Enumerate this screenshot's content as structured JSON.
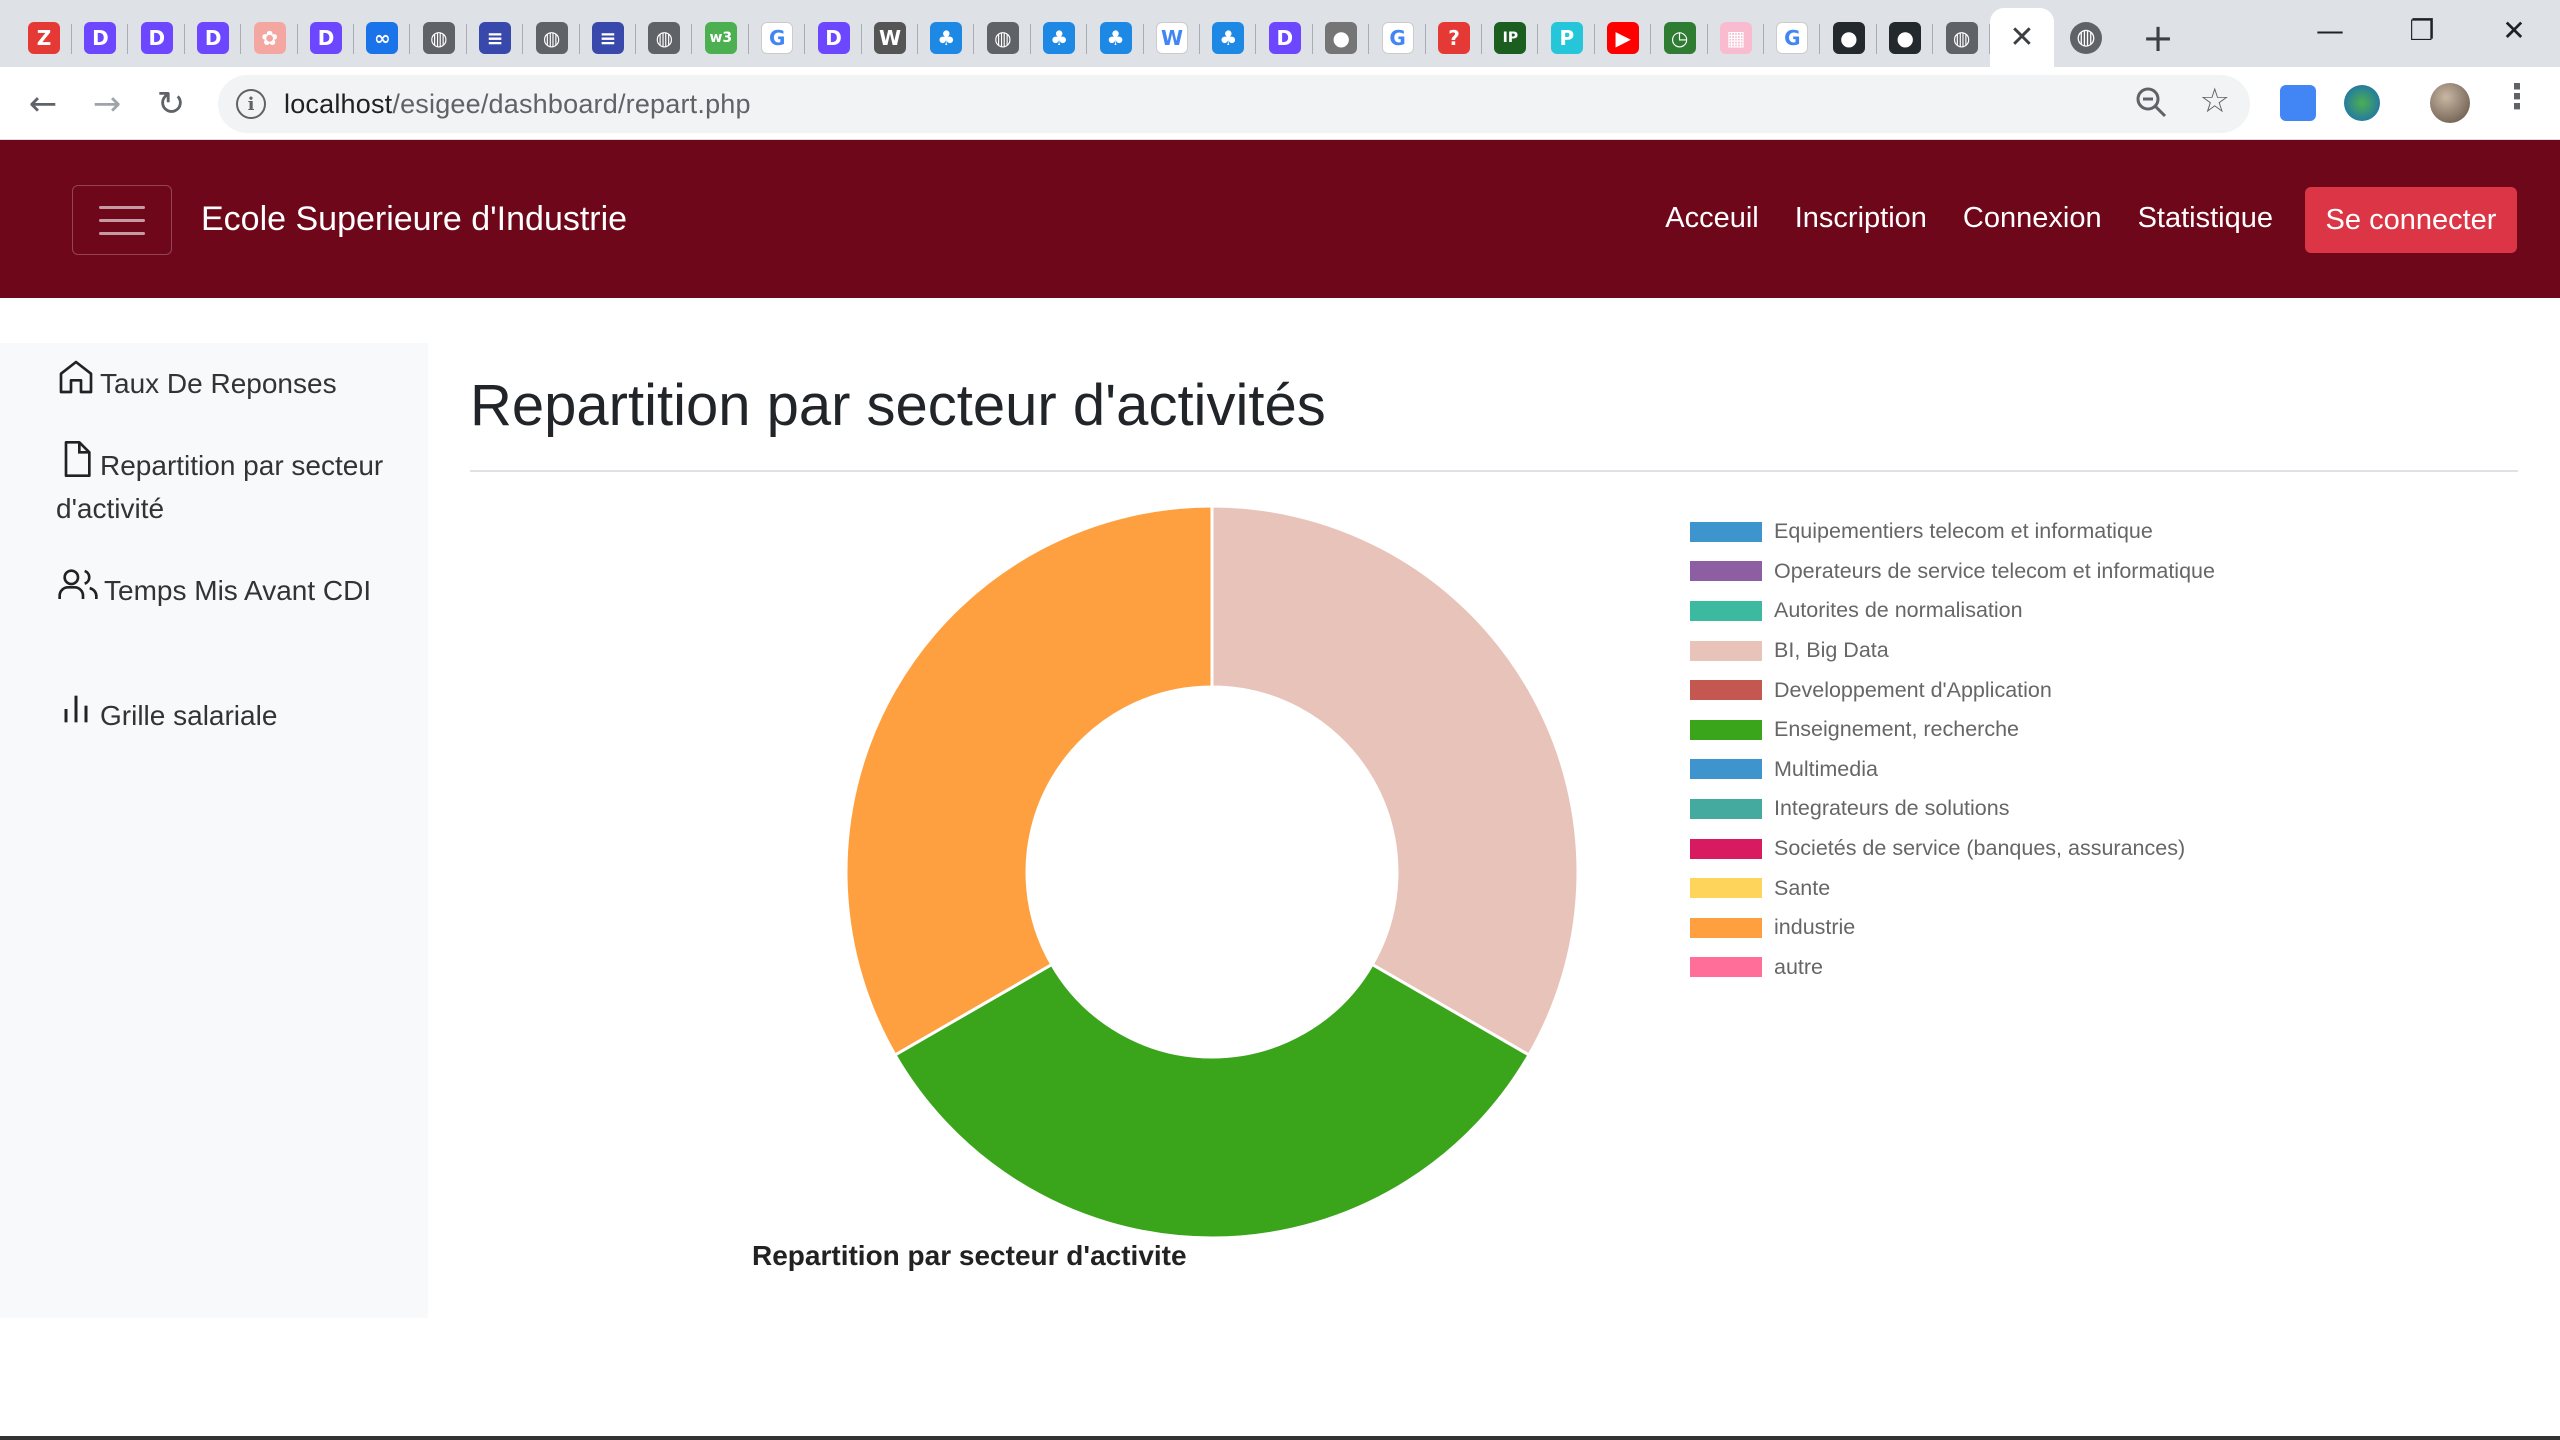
{
  "browser": {
    "favicons": [
      {
        "name": "zotero-icon",
        "color": "#e53935",
        "glyph": "Z"
      },
      {
        "name": "tab-app-icon",
        "color": "#6c47ff",
        "glyph": "D"
      },
      {
        "name": "tab-app-icon",
        "color": "#6c47ff",
        "glyph": "D"
      },
      {
        "name": "tab-app-icon",
        "color": "#6c47ff",
        "glyph": "D"
      },
      {
        "name": "cookie-icon",
        "color": "#f4a7a0",
        "glyph": "✿"
      },
      {
        "name": "tab-app-icon",
        "color": "#6c47ff",
        "glyph": "D"
      },
      {
        "name": "infinity-icon",
        "color": "#1a73e8",
        "glyph": "∞"
      },
      {
        "name": "globe-icon",
        "color": "#5f6368",
        "glyph": "◍"
      },
      {
        "name": "stack-icon",
        "color": "#3949ab",
        "glyph": "≡"
      },
      {
        "name": "globe-icon",
        "color": "#5f6368",
        "glyph": "◍"
      },
      {
        "name": "stack-icon",
        "color": "#3949ab",
        "glyph": "≡"
      },
      {
        "name": "globe-icon",
        "color": "#5f6368",
        "glyph": "◍"
      },
      {
        "name": "w3-icon",
        "color": "#4caf50",
        "glyph": "w3"
      },
      {
        "name": "google-icon",
        "color": "#ffffff",
        "glyph": "G"
      },
      {
        "name": "tab-app-icon",
        "color": "#6c47ff",
        "glyph": "D"
      },
      {
        "name": "wp-icon",
        "color": "#555555",
        "glyph": "W"
      },
      {
        "name": "ghost-icon",
        "color": "#1e88e5",
        "glyph": "♣"
      },
      {
        "name": "globe-icon",
        "color": "#5f6368",
        "glyph": "◍"
      },
      {
        "name": "ghost-icon",
        "color": "#1e88e5",
        "glyph": "♣"
      },
      {
        "name": "ghost-icon",
        "color": "#1e88e5",
        "glyph": "♣"
      },
      {
        "name": "wikipedia-icon",
        "color": "#ffffff",
        "glyph": "W"
      },
      {
        "name": "ghost-icon",
        "color": "#1e88e5",
        "glyph": "♣"
      },
      {
        "name": "tab-app-icon",
        "color": "#6c47ff",
        "glyph": "D"
      },
      {
        "name": "disc-icon",
        "color": "#757575",
        "glyph": "●"
      },
      {
        "name": "google-icon",
        "color": "#ffffff",
        "glyph": "G"
      },
      {
        "name": "quora-icon",
        "color": "#e53935",
        "glyph": "?"
      },
      {
        "name": "ip-icon",
        "color": "#1b5e20",
        "glyph": "IP"
      },
      {
        "name": "p-icon",
        "color": "#26c6da",
        "glyph": "P"
      },
      {
        "name": "youtube-icon",
        "color": "#ff0000",
        "glyph": "▶"
      },
      {
        "name": "timer-icon",
        "color": "#2e7d32",
        "glyph": "◷"
      },
      {
        "name": "building-icon",
        "color": "#f8bbd0",
        "glyph": "▦"
      },
      {
        "name": "google-icon",
        "color": "#ffffff",
        "glyph": "G"
      },
      {
        "name": "github-icon",
        "color": "#24292e",
        "glyph": "●"
      },
      {
        "name": "github-icon",
        "color": "#24292e",
        "glyph": "●"
      },
      {
        "name": "globe-icon",
        "color": "#5f6368",
        "glyph": "◍"
      }
    ],
    "active_tab_close": "✕",
    "last_tab_icon": "◍",
    "new_tab": "+",
    "window_controls": {
      "minimize": "—",
      "restore": "❐",
      "close": "✕"
    },
    "url_host": "localhost",
    "url_path": "/esigee/dashboard/repart.php"
  },
  "navbar": {
    "brand": "Ecole Superieure d'Industrie",
    "links": [
      "Acceuil",
      "Inscription",
      "Connexion",
      "Statistique"
    ],
    "cta": "Se connecter",
    "bg_color": "#6f071b",
    "cta_color": "#dc3545"
  },
  "sidebar": {
    "items": [
      {
        "label": "Taux De Reponses",
        "icon": "home-icon"
      },
      {
        "label": "Repartition par secteur d'activité",
        "icon": "file-icon"
      },
      {
        "label": "Temps Mis Avant CDI",
        "icon": "users-icon"
      },
      {
        "label": "Grille salariale",
        "icon": "bar-chart-icon"
      }
    ]
  },
  "main": {
    "title": "Repartition par secteur d'activités"
  },
  "chart_data": {
    "type": "pie",
    "title": "Repartition par secteur d'activite",
    "donut": true,
    "legend_position": "right",
    "categories": [
      "Equipementiers telecom et informatique",
      "Operateurs de service telecom et informatique",
      "Autorites de normalisation",
      "BI, Big Data",
      "Developpement d'Application",
      "Enseignement, recherche",
      "Multimedia",
      "Integrateurs de solutions",
      "Societés de service (banques, assurances)",
      "Sante",
      "industrie",
      "autre"
    ],
    "values": [
      0,
      0,
      0,
      1,
      0,
      1,
      0,
      0,
      0,
      0,
      1,
      0
    ],
    "colors": [
      "#3e95cd",
      "#8e5ea2",
      "#3cba9f",
      "#e8c3b9",
      "#c45850",
      "#3aa41a",
      "#3e95cd",
      "#44aaa0",
      "#d81b60",
      "#ffd45a",
      "#ffa040",
      "#ff6e99"
    ]
  }
}
